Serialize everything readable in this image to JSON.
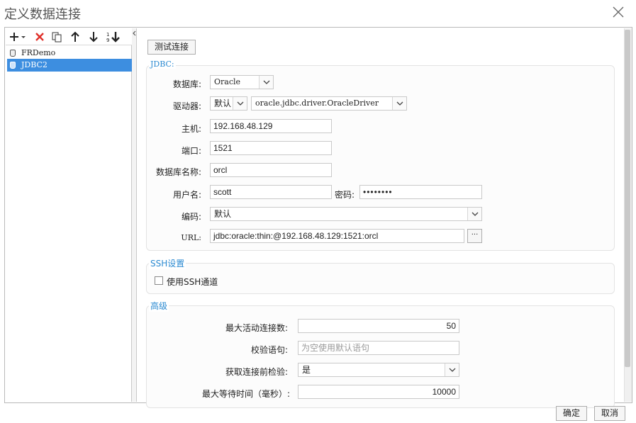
{
  "window": {
    "title": "定义数据连接"
  },
  "left": {
    "connections": [
      {
        "label": "FRDemo",
        "selected": false
      },
      {
        "label": "JDBC2",
        "selected": true
      }
    ],
    "toolbar": [
      "add-icon",
      "delete-icon",
      "copy-icon",
      "move-up-icon",
      "move-down-icon",
      "sort-icon"
    ]
  },
  "right": {
    "test_button": "测试连接",
    "jdbc": {
      "title": "JDBC:",
      "database_label": "数据库:",
      "database_value": "Oracle",
      "driver_label": "驱动器:",
      "driver_mode": "默认",
      "driver_value": "oracle.jdbc.driver.OracleDriver",
      "host_label": "主机:",
      "host_value": "192.168.48.129",
      "port_label": "端口:",
      "port_value": "1521",
      "dbname_label": "数据库名称:",
      "dbname_value": "orcl",
      "user_label": "用户名:",
      "user_value": "scott",
      "password_label": "密码:",
      "password_value": "••••••••",
      "encoding_label": "编码:",
      "encoding_value": "默认",
      "url_label": "URL:",
      "url_value": "jdbc:oracle:thin:@192.168.48.129:1521:orcl",
      "url_more": "···"
    },
    "ssh": {
      "title": "SSH设置",
      "checkbox_label": "使用SSH通道",
      "checked": false
    },
    "advanced": {
      "title": "高级",
      "max_active_label": "最大活动连接数:",
      "max_active_value": "50",
      "validation_label": "校验语句:",
      "validation_placeholder": "为空使用默认语句",
      "test_before_label": "获取连接前检验:",
      "test_before_value": "是",
      "max_wait_label": "最大等待时间（毫秒）:",
      "max_wait_value": "10000"
    }
  },
  "footer": {
    "ok": "确定",
    "cancel": "取消"
  },
  "colors": {
    "accent": "#2b8ad1",
    "selection": "#3d8ee0",
    "delete": "#e0302a"
  }
}
